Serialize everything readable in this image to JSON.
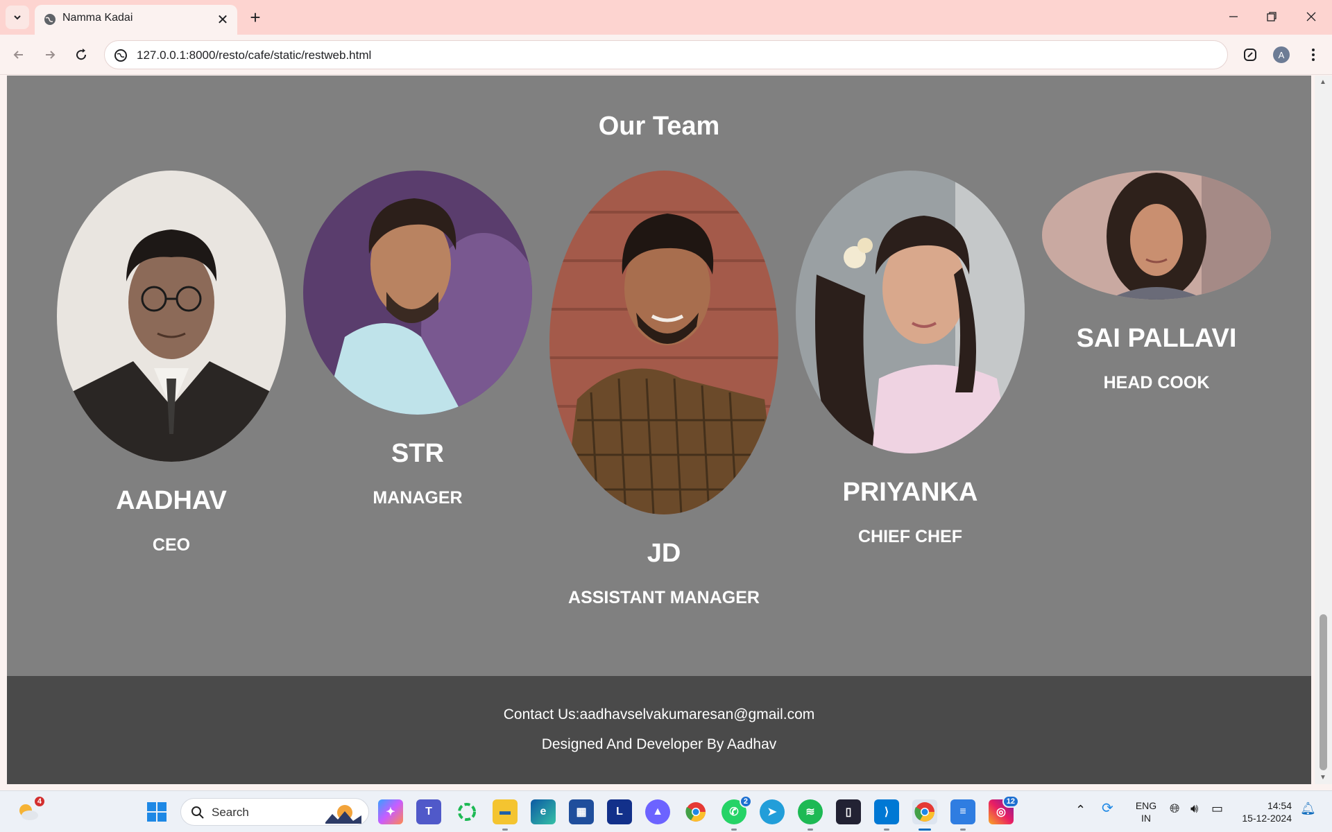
{
  "browser": {
    "tab_title": "Namma Kadai",
    "url": "127.0.0.1:8000/resto/cafe/static/restweb.html",
    "profile_initial": "A"
  },
  "page": {
    "team_title": "Our Team",
    "members": [
      {
        "name": "AADHAV",
        "role": "CEO"
      },
      {
        "name": "STR",
        "role": "MANAGER"
      },
      {
        "name": "JD",
        "role": "ASSISTANT MANAGER"
      },
      {
        "name": "PRIYANKA",
        "role": "CHIEF CHEF"
      },
      {
        "name": "SAI PALLAVI",
        "role": "HEAD COOK"
      }
    ],
    "footer": {
      "contact": "Contact Us:aadhavselvakumaresan@gmail.com",
      "credit": "Designed And Developer By Aadhav"
    }
  },
  "taskbar": {
    "search_placeholder": "Search",
    "weather_badge": "4",
    "teams_badge": "",
    "whatsapp_badge": "2",
    "instagram_badge": "12",
    "lang_line1": "ENG",
    "lang_line2": "IN",
    "time": "14:54",
    "date": "15-12-2024"
  },
  "colors": {
    "page_bg": "#808080",
    "footer_bg": "#4a4a4a",
    "tabbar_bg": "#fdd4d0",
    "text": "#ffffff"
  }
}
